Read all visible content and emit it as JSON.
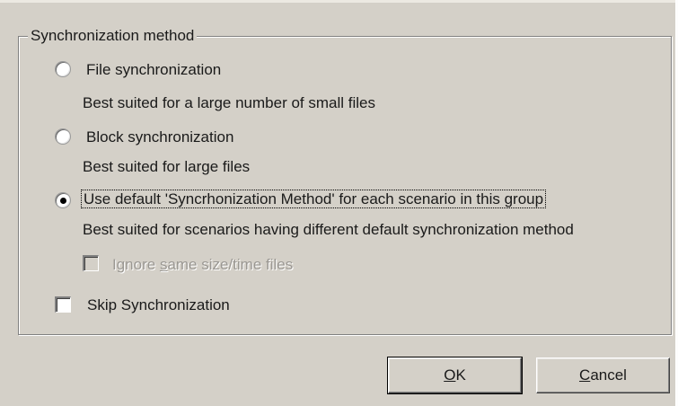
{
  "group": {
    "title": "Synchronization method"
  },
  "options": {
    "file_sync": {
      "label": "File synchronization",
      "description": "Best suited for a large number of small files",
      "selected": false
    },
    "block_sync": {
      "label": "Block synchronization",
      "description": "Best suited for large files",
      "selected": false
    },
    "default_sync": {
      "label": "Use default 'Syncrhonization Method' for each scenario in this group",
      "description": "Best suited for scenarios having different default synchronization method",
      "selected": true
    }
  },
  "ignore_same": {
    "label_pre": "Ignore ",
    "label_accel": "s",
    "label_post": "ame size/time files",
    "checked": false,
    "enabled": false
  },
  "skip_sync": {
    "label": "Skip Synchronization",
    "checked": false
  },
  "buttons": {
    "ok": {
      "accel": "O",
      "rest": "K"
    },
    "cancel": {
      "accel": "C",
      "rest": "ancel"
    }
  }
}
